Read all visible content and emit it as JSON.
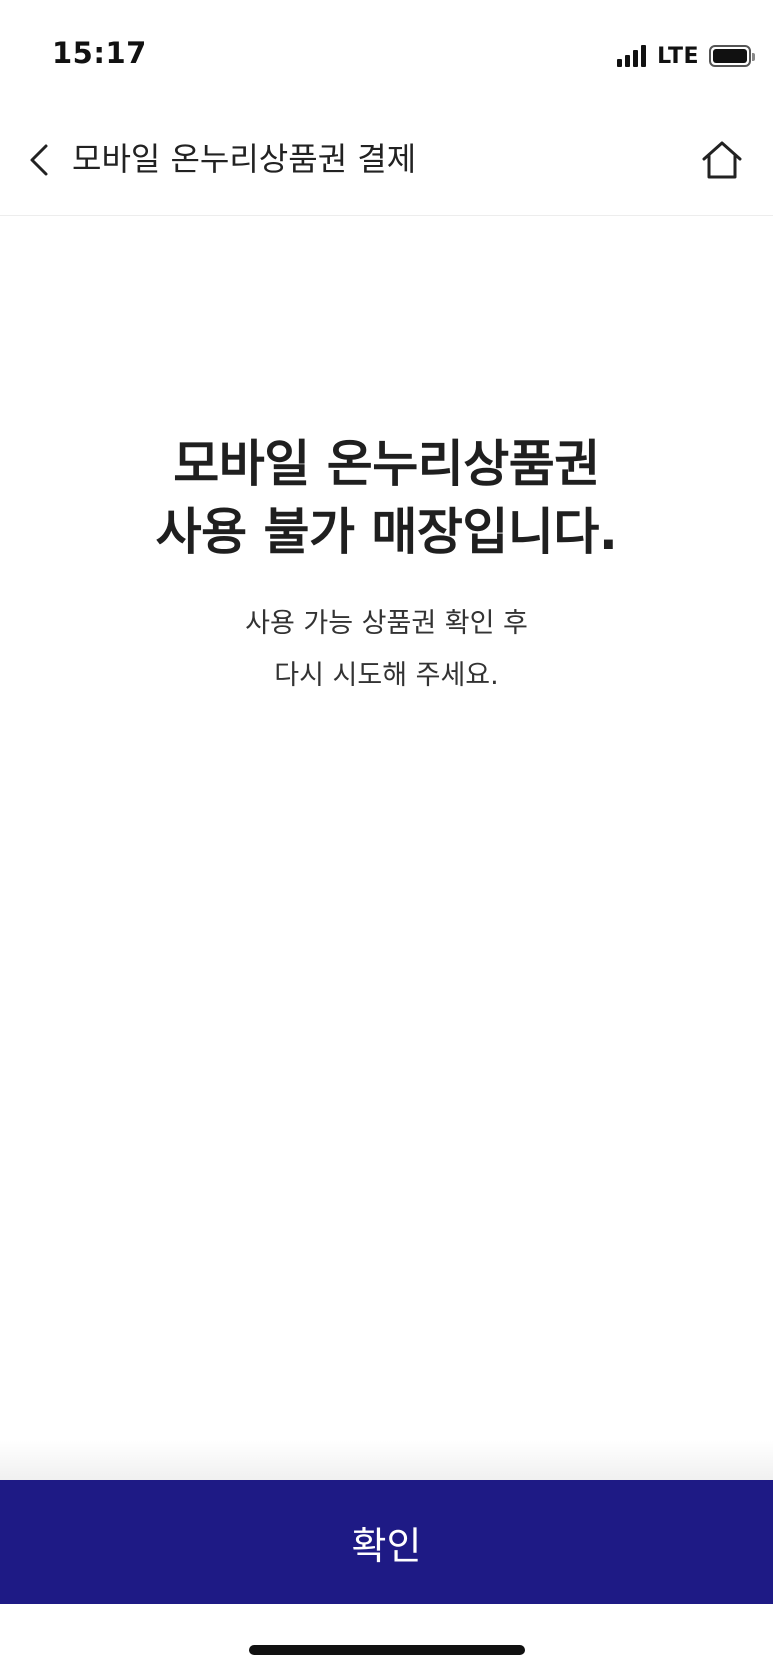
{
  "status_bar": {
    "time": "15:17",
    "network": "LTE",
    "signal_icon": "signal-bars-icon",
    "battery_icon": "battery-icon"
  },
  "header": {
    "title": "모바일 온누리상품권 결제",
    "back_icon": "chevron-left-icon",
    "home_icon": "home-icon"
  },
  "message": {
    "title_line1": "모바일 온누리상품권",
    "title_line2": "사용 불가 매장입니다.",
    "sub_line1": "사용 가능 상품권 확인 후",
    "sub_line2": "다시 시도해 주세요."
  },
  "footer": {
    "confirm_label": "확인"
  },
  "colors": {
    "primary": "#1e1a85",
    "text": "#222222",
    "background": "#ffffff"
  }
}
